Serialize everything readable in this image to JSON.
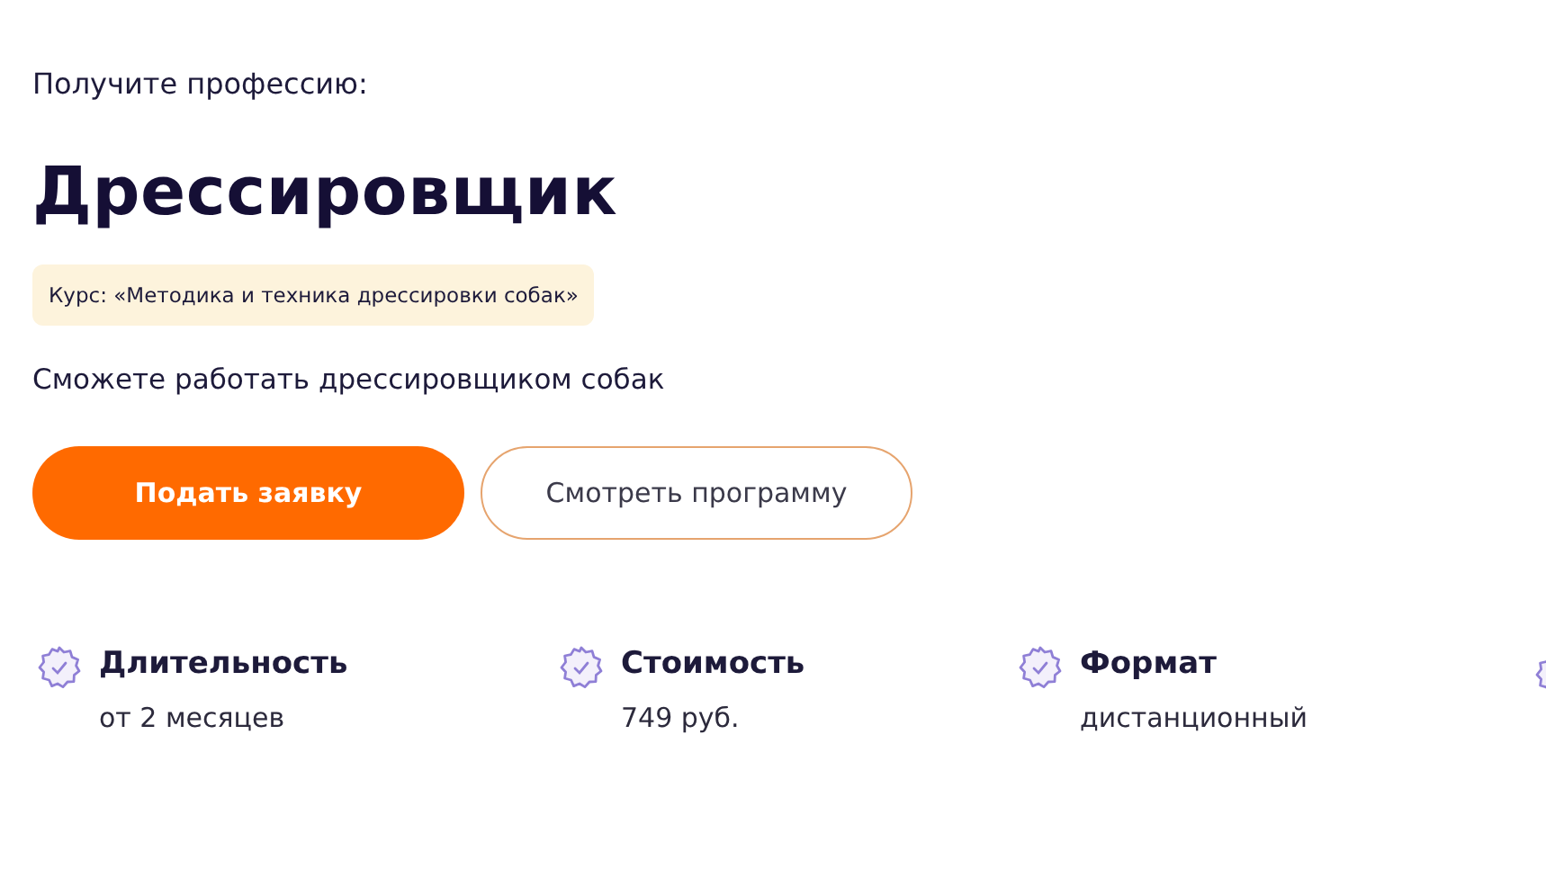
{
  "eyebrow": "Получите профессию:",
  "title": "Дрессировщик",
  "course_tag": "Курс: «Методика и техника дрессировки собак»",
  "description": "Сможете работать дрессировщиком собак",
  "buttons": [
    {
      "label": "Подать заявку",
      "kind": "primary"
    },
    {
      "label": "Смотреть программу",
      "kind": "outline"
    }
  ],
  "features": [
    {
      "title": "Длительность",
      "value": "от 2 месяцев"
    },
    {
      "title": "Стоимость",
      "value": "749 руб."
    },
    {
      "title": "Формат",
      "value": "дистанционный"
    }
  ]
}
